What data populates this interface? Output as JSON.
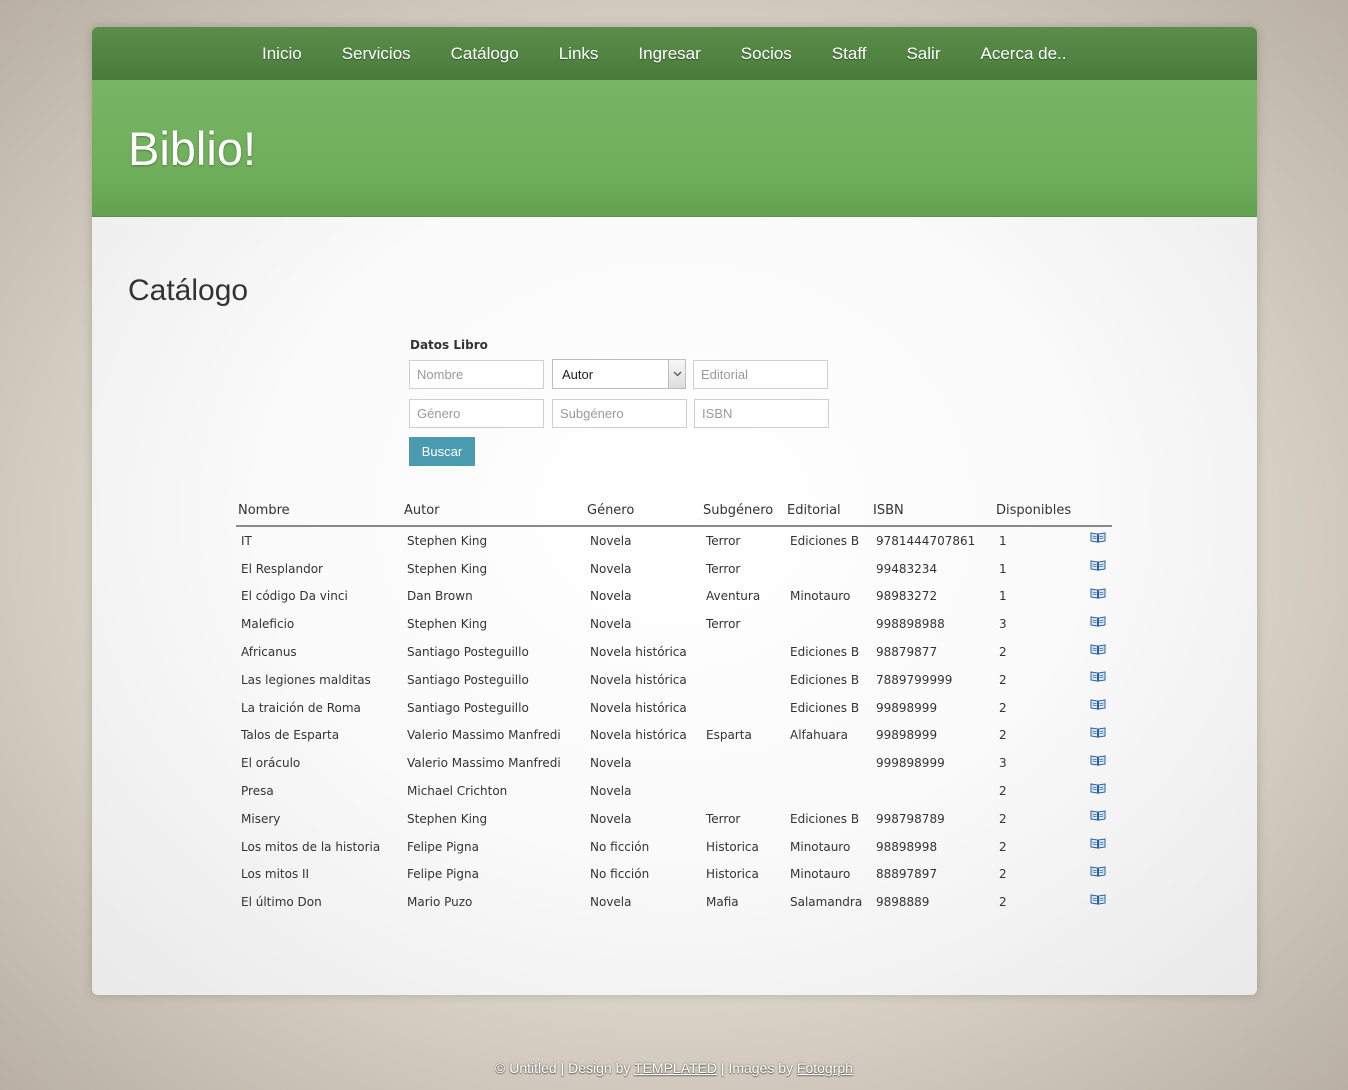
{
  "nav": {
    "items": [
      "Inicio",
      "Servicios",
      "Catálogo",
      "Links",
      "Ingresar",
      "Socios",
      "Staff",
      "Salir",
      "Acerca de.."
    ]
  },
  "banner": {
    "title": "Biblio!"
  },
  "page": {
    "title": "Catálogo"
  },
  "search_form": {
    "legend": "Datos Libro",
    "nombre_placeholder": "Nombre",
    "autor_selected": "Autor",
    "editorial_placeholder": "Editorial",
    "genero_placeholder": "Género",
    "subgenero_placeholder": "Subgénero",
    "isbn_placeholder": "ISBN",
    "submit_label": "Buscar"
  },
  "table": {
    "headers": [
      "Nombre",
      "Autor",
      "Género",
      "Subgénero",
      "Editorial",
      "ISBN",
      "Disponibles"
    ],
    "rows": [
      [
        "IT",
        "Stephen King",
        "Novela",
        "Terror",
        "Ediciones B",
        "9781444707861",
        "1"
      ],
      [
        "El Resplandor",
        "Stephen King",
        "Novela",
        "Terror",
        "",
        "99483234",
        "1"
      ],
      [
        "El código Da vinci",
        "Dan Brown",
        "Novela",
        "Aventura",
        "Minotauro",
        "98983272",
        "1"
      ],
      [
        "Maleficio",
        "Stephen King",
        "Novela",
        "Terror",
        "",
        "998898988",
        "3"
      ],
      [
        "Africanus",
        "Santiago Posteguillo",
        "Novela histórica",
        "",
        "Ediciones B",
        "98879877",
        "2"
      ],
      [
        "Las legiones malditas",
        "Santiago Posteguillo",
        "Novela histórica",
        "",
        "Ediciones B",
        "7889799999",
        "2"
      ],
      [
        "La traición de Roma",
        "Santiago Posteguillo",
        "Novela histórica",
        "",
        "Ediciones B",
        "99898999",
        "2"
      ],
      [
        "Talos de Esparta",
        "Valerio Massimo Manfredi",
        "Novela histórica",
        "Esparta",
        "Alfahuara",
        "99898999",
        "2"
      ],
      [
        "El oráculo",
        "Valerio Massimo Manfredi",
        "Novela",
        "",
        "",
        "999898999",
        "3"
      ],
      [
        "Presa",
        "Michael Crichton",
        "Novela",
        "",
        "",
        "",
        "2"
      ],
      [
        "Misery",
        "Stephen King",
        "Novela",
        "Terror",
        "Ediciones B",
        "998798789",
        "2"
      ],
      [
        "Los mitos de la historia",
        "Felipe Pigna",
        "No ficción",
        "Historica",
        "Minotauro",
        "98898998",
        "2"
      ],
      [
        "Los mitos II",
        "Felipe Pigna",
        "No ficción",
        "Historica",
        "Minotauro",
        "88897897",
        "2"
      ],
      [
        "El último Don",
        "Mario Puzo",
        "Novela",
        "Mafia",
        "Salamandra",
        "9898889",
        "2"
      ]
    ],
    "row_icon": "open-book-icon"
  },
  "footer": {
    "prefix": "© Untitled | Design by",
    "templated_link": "TEMPLATED",
    "middle": "| Images by",
    "fotogrph_link": "Fotogrph"
  },
  "colors": {
    "nav_bar": "#4f8241",
    "banner": "#72b05e",
    "button": "#4a9ab0"
  }
}
